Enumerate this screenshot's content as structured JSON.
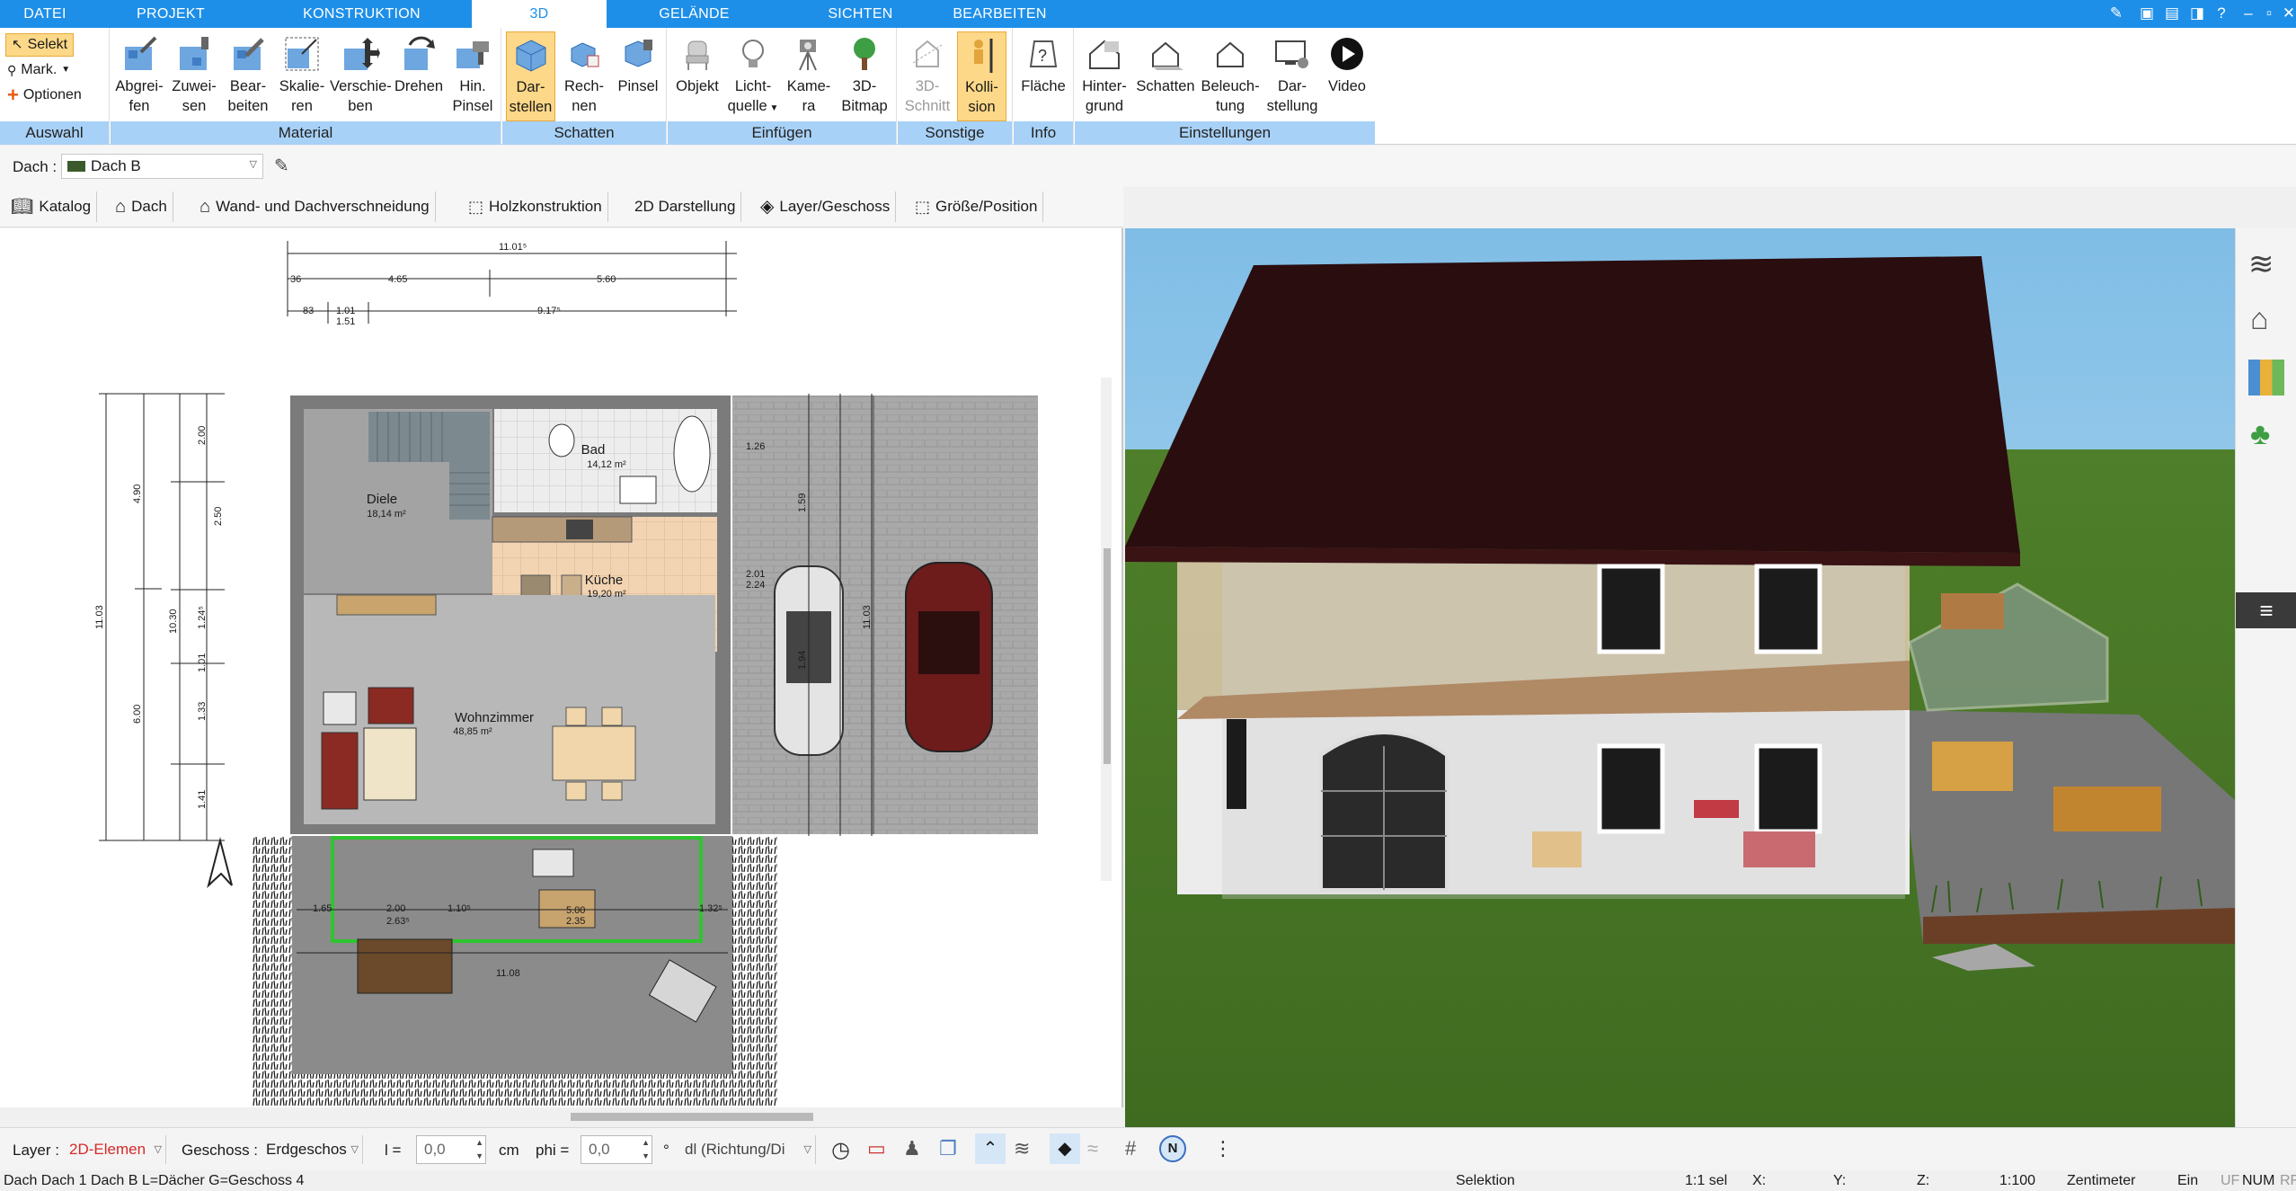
{
  "tabs": {
    "datei": "DATEI",
    "projekt": "PROJEKT",
    "konstruktion": "KONSTRUKTION",
    "d3": "3D",
    "gelaende": "GELÄNDE",
    "sichten": "SICHTEN",
    "bearbeiten": "BEARBEITEN"
  },
  "ribbon": {
    "auswahl": {
      "selekt": "Selekt",
      "mark": "Mark.",
      "optionen": "Optionen",
      "label": "Auswahl"
    },
    "material": {
      "label": "Material",
      "abgreifen": [
        "Abgrei-",
        "fen"
      ],
      "zuweisen": [
        "Zuwei-",
        "sen"
      ],
      "bearbeiten": [
        "Bear-",
        "beiten"
      ],
      "skalieren": [
        "Skalie-",
        "ren"
      ],
      "verschieben": [
        "Verschie-",
        "ben"
      ],
      "drehen": [
        "Drehen",
        ""
      ],
      "hinpinsel": [
        "Hin.",
        "Pinsel"
      ]
    },
    "schatten": {
      "label": "Schatten",
      "darstellen": [
        "Dar-",
        "stellen"
      ],
      "rechnen": [
        "Rech-",
        "nen"
      ],
      "pinsel": [
        "Pinsel",
        ""
      ]
    },
    "einfuegen": {
      "label": "Einfügen",
      "objekt": [
        "Objekt",
        ""
      ],
      "lichtquelle": [
        "Licht-",
        "quelle"
      ],
      "kamera": [
        "Kame-",
        "ra"
      ],
      "bitmap3d": [
        "3D-",
        "Bitmap"
      ]
    },
    "sonstige": {
      "label": "Sonstige",
      "schnitt": [
        "3D-",
        "Schnitt"
      ],
      "kollision": [
        "Kolli-",
        "sion"
      ]
    },
    "info": {
      "label": "Info",
      "flaeche": [
        "Fläche",
        ""
      ]
    },
    "einstellungen": {
      "label": "Einstellungen",
      "hintergrund": [
        "Hinter-",
        "grund"
      ],
      "schatten": [
        "Schatten",
        ""
      ],
      "beleuchtung": [
        "Beleuch-",
        "tung"
      ],
      "darstellung": [
        "Dar-",
        "stellung"
      ],
      "video": [
        "Video",
        ""
      ]
    }
  },
  "roofbar": {
    "label": "Dach :",
    "value": "Dach B"
  },
  "tooltabs": {
    "katalog": "Katalog",
    "dach": "Dach",
    "wand": "Wand- und Dachverschneidung",
    "holz": "Holzkonstruktion",
    "darst2d": "2D Darstellung",
    "layer": "Layer/Geschoss",
    "groesse": "Größe/Position"
  },
  "plan": {
    "rooms": {
      "bad": "Bad",
      "bad_area": "14,12 m²",
      "diele": "Diele",
      "diele_area": "18,14 m²",
      "kueche": "Küche",
      "kueche_area": "19,20 m²",
      "wohnzimmer": "Wohnzimmer",
      "wohnzimmer_area": "48,85 m²"
    },
    "dims": {
      "top_total": "11.01⁵",
      "top_a": "4.65",
      "top_b": "5.60",
      "top_c": "9.17⁵",
      "top_d": "1.01",
      "top_e": "1.51",
      "top_f": "83",
      "top_g": "36",
      "left_total": "11.03",
      "left_a": "4.90",
      "left_b": "10.30",
      "left_c": "6.00",
      "left_d": "2.00",
      "left_e": "2.50",
      "left_f": "1.24⁵",
      "left_g": "1.01",
      "left_h": "1.33",
      "left_i": "1.41",
      "right_total": "11.03",
      "right_a": "1.26",
      "right_b": "1.59",
      "right_c": "2.01",
      "right_d": "2.24",
      "right_e": "1.94",
      "terr_a": "2.00",
      "terr_b": "2.63⁵",
      "terr_c": "1.10⁵",
      "terr_d": "1.65",
      "terr_e": "1.32⁵",
      "terr_f": "11.08",
      "terr_g": "5.00",
      "terr_h": "2.35"
    }
  },
  "bottombar": {
    "layer_label": "Layer :",
    "layer_value": "2D-Elemen",
    "geschoss_label": "Geschoss :",
    "geschoss_value": "Erdgeschos",
    "l_label": "l =",
    "l_value": "0,0",
    "cm": "cm",
    "phi_label": "phi =",
    "phi_value": "0,0",
    "deg": "°",
    "dl_value": "dl (Richtung/Di"
  },
  "statusbar": {
    "left": "Dach Dach 1 Dach B L=Dächer G=Geschoss 4",
    "selektion": "Selektion",
    "sel": "1:1 sel",
    "x": "X:",
    "y": "Y:",
    "z": "Z:",
    "scale": "1:100",
    "unit": "Zentimeter",
    "ein": "Ein",
    "uf": "UF",
    "num": "NUM",
    "rf": "RF"
  },
  "colors": {
    "accent": "#1e8fe8",
    "group_footer": "#a8d1f7",
    "selected": "#fcd888",
    "roof": "#2a0d0f",
    "grass": "#4e7d2b",
    "sky": "#a9d3ee"
  }
}
